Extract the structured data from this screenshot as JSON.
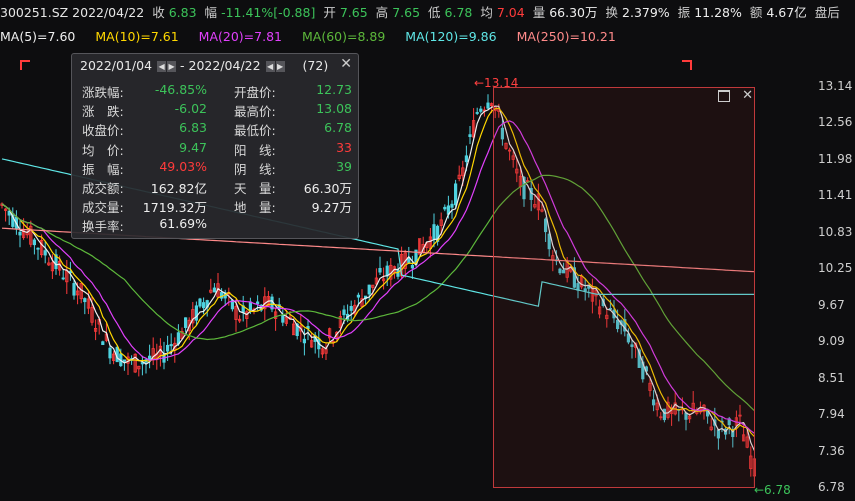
{
  "quote": {
    "code_date": "300251.SZ 2022/04/22",
    "close_label": "收",
    "close": "6.83",
    "chg_label": "幅",
    "chg": "-11.41%[-0.88]",
    "open_label": "开",
    "open": "7.65",
    "high_label": "高",
    "high": "7.65",
    "low_label": "低",
    "low": "6.78",
    "avg_label": "均",
    "avg": "7.04",
    "vol_label": "量",
    "vol": "66.30万",
    "turn_label": "换",
    "turn": "2.379%",
    "amp_label": "振",
    "amp": "11.28%",
    "amt_label": "额",
    "amt": "4.67亿",
    "extra": "盘后"
  },
  "ma": [
    {
      "label": "MA(5)=7.60",
      "color": "#f0f0f0"
    },
    {
      "label": "MA(10)=7.61",
      "color": "#ffd700"
    },
    {
      "label": "MA(20)=7.81",
      "color": "#e040fb"
    },
    {
      "label": "MA(60)=8.89",
      "color": "#5db83b"
    },
    {
      "label": "MA(120)=9.86",
      "color": "#5fe6e6"
    },
    {
      "label": "MA(250)=10.21",
      "color": "#ff8a8a"
    }
  ],
  "panel": {
    "start_date": "2022/01/04",
    "sep": "-",
    "end_date": "2022/04/22",
    "count": "(72)",
    "close_icon": "close-icon",
    "rows": [
      {
        "l1": "涨跌幅:",
        "v1": "-46.85%",
        "c1": "green",
        "l2": "开盘价:",
        "v2": "12.73",
        "c2": "green"
      },
      {
        "l1": "涨　跌:",
        "v1": "-6.02",
        "c1": "green",
        "l2": "最高价:",
        "v2": "13.08",
        "c2": "green"
      },
      {
        "l1": "收盘价:",
        "v1": "6.83",
        "c1": "green",
        "l2": "最低价:",
        "v2": "6.78",
        "c2": "green"
      },
      {
        "l1": "均　价:",
        "v1": "9.47",
        "c1": "green",
        "l2": "阳　线:",
        "v2": "33",
        "c2": "red"
      },
      {
        "l1": "振　幅:",
        "v1": "49.03%",
        "c1": "red",
        "l2": "阴　线:",
        "v2": "39",
        "c2": "green"
      },
      {
        "l1": "成交额:",
        "v1": "162.82亿",
        "c1": "white",
        "l2": "天　量:",
        "v2": "66.30万",
        "c2": "white"
      },
      {
        "l1": "成交量:",
        "v1": "1719.32万",
        "c1": "white",
        "l2": "地　量:",
        "v2": "9.27万",
        "c2": "white"
      },
      {
        "l1": "换手率:",
        "v1": "61.69%",
        "c1": "white",
        "l2": "",
        "v2": "",
        "c2": "white"
      }
    ]
  },
  "markers": {
    "high": "←13.14",
    "low": "←6.78"
  },
  "yaxis": {
    "ticks": [
      "13.14",
      "12.56",
      "11.98",
      "11.41",
      "10.83",
      "10.25",
      "9.67",
      "9.09",
      "8.51",
      "7.94",
      "7.36",
      "6.78"
    ]
  },
  "chart_data": {
    "type": "candlestick",
    "ylim": [
      6.78,
      13.14
    ],
    "selection": {
      "start": "2022/01/04",
      "end": "2022/04/22",
      "bars": 72
    },
    "series": [
      {
        "name": "MA(5)",
        "last": 7.6
      },
      {
        "name": "MA(10)",
        "last": 7.61
      },
      {
        "name": "MA(20)",
        "last": 7.81
      },
      {
        "name": "MA(60)",
        "last": 8.89
      },
      {
        "name": "MA(120)",
        "last": 9.86
      },
      {
        "name": "MA(250)",
        "last": 10.21
      }
    ]
  }
}
